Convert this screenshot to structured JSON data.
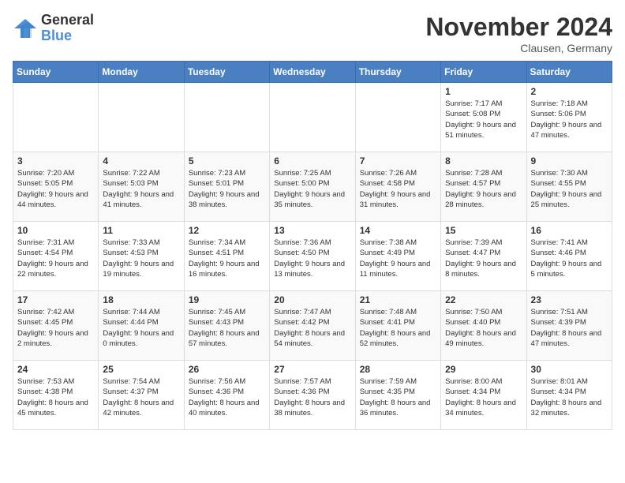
{
  "header": {
    "logo_general": "General",
    "logo_blue": "Blue",
    "title": "November 2024",
    "location": "Clausen, Germany"
  },
  "days_of_week": [
    "Sunday",
    "Monday",
    "Tuesday",
    "Wednesday",
    "Thursday",
    "Friday",
    "Saturday"
  ],
  "weeks": [
    [
      {
        "day": "",
        "detail": ""
      },
      {
        "day": "",
        "detail": ""
      },
      {
        "day": "",
        "detail": ""
      },
      {
        "day": "",
        "detail": ""
      },
      {
        "day": "",
        "detail": ""
      },
      {
        "day": "1",
        "detail": "Sunrise: 7:17 AM\nSunset: 5:08 PM\nDaylight: 9 hours and 51 minutes."
      },
      {
        "day": "2",
        "detail": "Sunrise: 7:18 AM\nSunset: 5:06 PM\nDaylight: 9 hours and 47 minutes."
      }
    ],
    [
      {
        "day": "3",
        "detail": "Sunrise: 7:20 AM\nSunset: 5:05 PM\nDaylight: 9 hours and 44 minutes."
      },
      {
        "day": "4",
        "detail": "Sunrise: 7:22 AM\nSunset: 5:03 PM\nDaylight: 9 hours and 41 minutes."
      },
      {
        "day": "5",
        "detail": "Sunrise: 7:23 AM\nSunset: 5:01 PM\nDaylight: 9 hours and 38 minutes."
      },
      {
        "day": "6",
        "detail": "Sunrise: 7:25 AM\nSunset: 5:00 PM\nDaylight: 9 hours and 35 minutes."
      },
      {
        "day": "7",
        "detail": "Sunrise: 7:26 AM\nSunset: 4:58 PM\nDaylight: 9 hours and 31 minutes."
      },
      {
        "day": "8",
        "detail": "Sunrise: 7:28 AM\nSunset: 4:57 PM\nDaylight: 9 hours and 28 minutes."
      },
      {
        "day": "9",
        "detail": "Sunrise: 7:30 AM\nSunset: 4:55 PM\nDaylight: 9 hours and 25 minutes."
      }
    ],
    [
      {
        "day": "10",
        "detail": "Sunrise: 7:31 AM\nSunset: 4:54 PM\nDaylight: 9 hours and 22 minutes."
      },
      {
        "day": "11",
        "detail": "Sunrise: 7:33 AM\nSunset: 4:53 PM\nDaylight: 9 hours and 19 minutes."
      },
      {
        "day": "12",
        "detail": "Sunrise: 7:34 AM\nSunset: 4:51 PM\nDaylight: 9 hours and 16 minutes."
      },
      {
        "day": "13",
        "detail": "Sunrise: 7:36 AM\nSunset: 4:50 PM\nDaylight: 9 hours and 13 minutes."
      },
      {
        "day": "14",
        "detail": "Sunrise: 7:38 AM\nSunset: 4:49 PM\nDaylight: 9 hours and 11 minutes."
      },
      {
        "day": "15",
        "detail": "Sunrise: 7:39 AM\nSunset: 4:47 PM\nDaylight: 9 hours and 8 minutes."
      },
      {
        "day": "16",
        "detail": "Sunrise: 7:41 AM\nSunset: 4:46 PM\nDaylight: 9 hours and 5 minutes."
      }
    ],
    [
      {
        "day": "17",
        "detail": "Sunrise: 7:42 AM\nSunset: 4:45 PM\nDaylight: 9 hours and 2 minutes."
      },
      {
        "day": "18",
        "detail": "Sunrise: 7:44 AM\nSunset: 4:44 PM\nDaylight: 9 hours and 0 minutes."
      },
      {
        "day": "19",
        "detail": "Sunrise: 7:45 AM\nSunset: 4:43 PM\nDaylight: 8 hours and 57 minutes."
      },
      {
        "day": "20",
        "detail": "Sunrise: 7:47 AM\nSunset: 4:42 PM\nDaylight: 8 hours and 54 minutes."
      },
      {
        "day": "21",
        "detail": "Sunrise: 7:48 AM\nSunset: 4:41 PM\nDaylight: 8 hours and 52 minutes."
      },
      {
        "day": "22",
        "detail": "Sunrise: 7:50 AM\nSunset: 4:40 PM\nDaylight: 8 hours and 49 minutes."
      },
      {
        "day": "23",
        "detail": "Sunrise: 7:51 AM\nSunset: 4:39 PM\nDaylight: 8 hours and 47 minutes."
      }
    ],
    [
      {
        "day": "24",
        "detail": "Sunrise: 7:53 AM\nSunset: 4:38 PM\nDaylight: 8 hours and 45 minutes."
      },
      {
        "day": "25",
        "detail": "Sunrise: 7:54 AM\nSunset: 4:37 PM\nDaylight: 8 hours and 42 minutes."
      },
      {
        "day": "26",
        "detail": "Sunrise: 7:56 AM\nSunset: 4:36 PM\nDaylight: 8 hours and 40 minutes."
      },
      {
        "day": "27",
        "detail": "Sunrise: 7:57 AM\nSunset: 4:36 PM\nDaylight: 8 hours and 38 minutes."
      },
      {
        "day": "28",
        "detail": "Sunrise: 7:59 AM\nSunset: 4:35 PM\nDaylight: 8 hours and 36 minutes."
      },
      {
        "day": "29",
        "detail": "Sunrise: 8:00 AM\nSunset: 4:34 PM\nDaylight: 8 hours and 34 minutes."
      },
      {
        "day": "30",
        "detail": "Sunrise: 8:01 AM\nSunset: 4:34 PM\nDaylight: 8 hours and 32 minutes."
      }
    ]
  ]
}
